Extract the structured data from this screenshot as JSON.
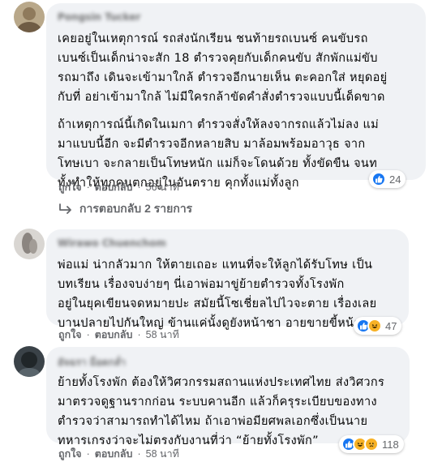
{
  "comments": [
    {
      "author": "Pongsin Tucker",
      "paragraphs": [
        [
          "เคยอยู่ในเหตุการณ์ รถส่งนักเรียน ชนท้ายรถเบนซ์ คนขับรถ",
          "เบนซ์เป็นเด็กน่าจะสัก 18 ตำรวจคุยกับเด็กคนขับ สักพักแม่ขับ",
          "รถมาถึง เดินจะเข้ามาใกล้ ตำรวจอีกนายเห็น ตะคอกใส่ หยุดอยู่",
          "กับที่ อย่าเข้ามาใกล้ ไม่มีใครกล้าขัดคำสั่งตำรวจแบบนี้เด็ดขาด"
        ],
        [
          "ถ้าเหตุการณ์นี้เกิดในเมกา ตำรวจสั่งให้ลงจากรถแล้วไม่ลง แม่",
          "มาแบบนี้อีก จะมีตำรวจอีกหลายสิบ มาล้อมพร้อมอาวุธ จาก",
          "โทษเบา จะกลายเป็นโทษหนัก แม่ก็จะโดนด้วย ทั้งขัดขืน จนท",
          "ทั้งทำให้ทุกคนตกอยู่ในอันตราย คุกทั้งแม่ทั้งลูก"
        ]
      ],
      "reaction_count": "24",
      "like_label": "ถูกใจ",
      "reply_label": "ตอบกลับ",
      "time": "56 นาที"
    },
    {
      "author": "Wirawo Chuenchom",
      "paragraphs": [
        [
          "พ่อแม่ น่ากลัวมาก ให้ตายเถอะ แทนที่จะให้ลูกได้รับโทษ เป็น",
          "บทเรียน เรื่องจบง่ายๆ นี่เอาพ่อมาขู่ย้ายตำรวจทั้งโรงพัก",
          "อยู่ในยุคเขียนจดหมายปะ สมัยนี้โซเชี่ยลไปไวจะตาย เรื่องเลย",
          "บานปลายไปกันใหญ่ ข้านแค่นั้งดูยังหน้าชา อายขายขี้หน้าแทน"
        ]
      ],
      "reaction_count": "47",
      "like_label": "ถูกใจ",
      "reply_label": "ตอบกลับ",
      "time": "58 นาที"
    },
    {
      "author": "อัจฉรา ม็อดกล่ำ",
      "paragraphs": [
        [
          "ย้ายทั้งโรงพัก ต้องให้วิศวกรรมสถานแห่งประเทศไทย ส่งวิศวกร",
          "มาตรวจดูฐานรากก่อน ระบบคานอีก แล้วก็ครุระเบียบของทาง",
          "ตำรวจว่าสามารถทำได้ไหม ถ้าเอาพ่อมียศพลเอกซึ่งเป็นนาย",
          "ทหารเกรงว่าจะไม่ตรงกับงานที่ว่า “ย้ายทั้งโรงพัก”"
        ]
      ],
      "reaction_count": "118",
      "like_label": "ถูกใจ",
      "reply_label": "ตอบกลับ",
      "time": "58 นาที"
    }
  ],
  "view_replies_label": "การตอบกลับ 2 รายการ",
  "colors": {
    "bubble": "#f0f2f5",
    "secondary_text": "#65676b",
    "like_blue": "#1877f2",
    "haha_yellow": "#f7b125"
  }
}
